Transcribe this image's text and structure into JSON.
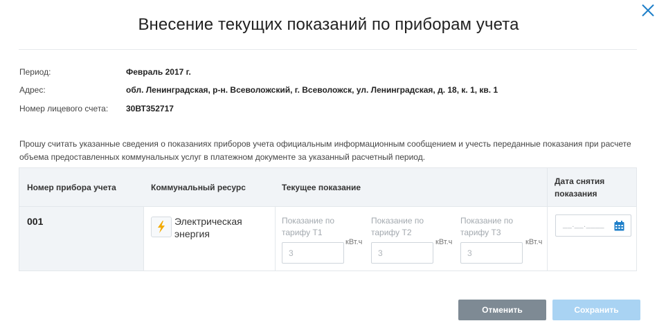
{
  "dialog": {
    "title": "Внесение текущих показаний по приборам учета"
  },
  "info": {
    "period_label": "Период:",
    "period_value": "Февраль 2017 г.",
    "address_label": "Адрес:",
    "address_value": "обл. Ленинградская, р-н. Всеволожский, г. Всеволожск, ул. Ленинградская, д. 18, к. 1, кв. 1",
    "account_label": "Номер лицевого счета:",
    "account_value": "30ВТ352717"
  },
  "notice": "Прошу считать указанные сведения о показаниях приборов учета официальным информационным сообщением и учесть переданные показания при расчете объема предоставленных коммунальных услуг в платежном документе за указанный расчетный период.",
  "table": {
    "headers": {
      "meter_number": "Номер прибора учета",
      "resource": "Коммунальный ресурс",
      "current_reading": "Текущее показание",
      "reading_date": "Дата снятия показания"
    },
    "row": {
      "meter_number": "001",
      "resource_icon": "lightning-icon",
      "resource_name": "Электрическая энергия",
      "tariffs": [
        {
          "label": "Показание по тарифу Т1",
          "unit": "кВт.ч",
          "placeholder": "3"
        },
        {
          "label": "Показание по тарифу Т2",
          "unit": "кВт.ч",
          "placeholder": "3"
        },
        {
          "label": "Показание по тарифу Т3",
          "unit": "кВт.ч",
          "placeholder": "3"
        }
      ],
      "date_mask": "__.__.____",
      "date_icon": "calendar-icon"
    }
  },
  "buttons": {
    "cancel": "Отменить",
    "save": "Сохранить"
  },
  "colors": {
    "accent": "#1e7fc9",
    "cancel_bg": "#7e8a94",
    "save_bg_disabled": "#a9d3f3",
    "lightning": "#f2a900"
  }
}
